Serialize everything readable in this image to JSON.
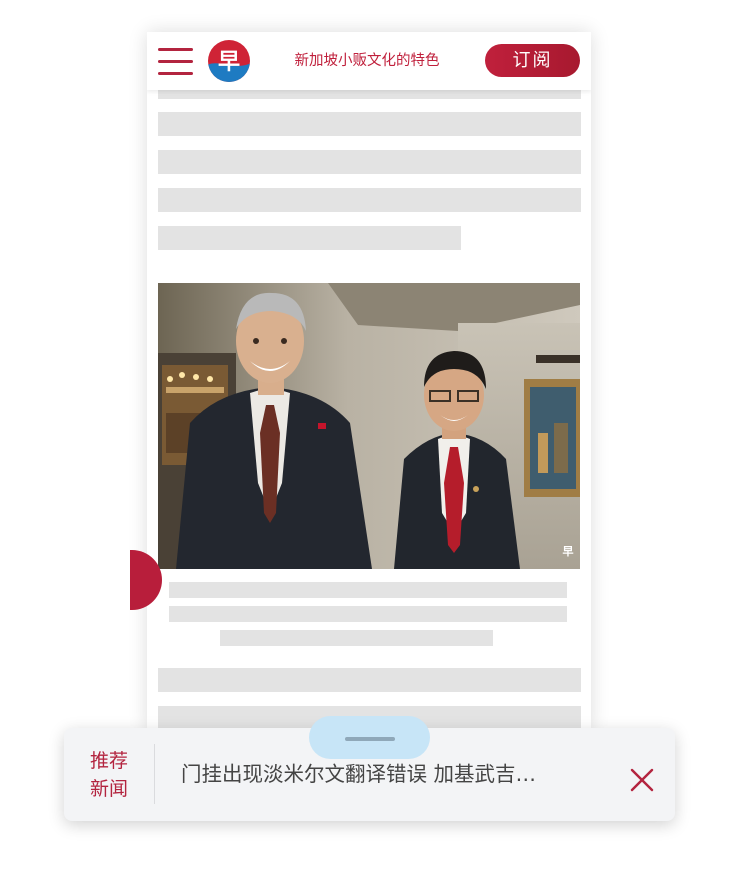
{
  "header": {
    "title": "新加坡小贩文化的特色",
    "subscribe_label": "订阅",
    "logo_char": "早",
    "menu_icon": "hamburger-menu-icon",
    "brand_color": "#b3243f"
  },
  "article": {
    "photo_alt": "two-men-in-suits-photo",
    "photo_watermark_char": "早",
    "skeleton_color": "#e3e3e3"
  },
  "recommend": {
    "label_line1": "推荐",
    "label_line2": "新闻",
    "headline": "门挂出现淡米尔文翻译错误 加基武吉…",
    "close_icon": "close-icon",
    "handle_color": "#c7e5f7"
  }
}
